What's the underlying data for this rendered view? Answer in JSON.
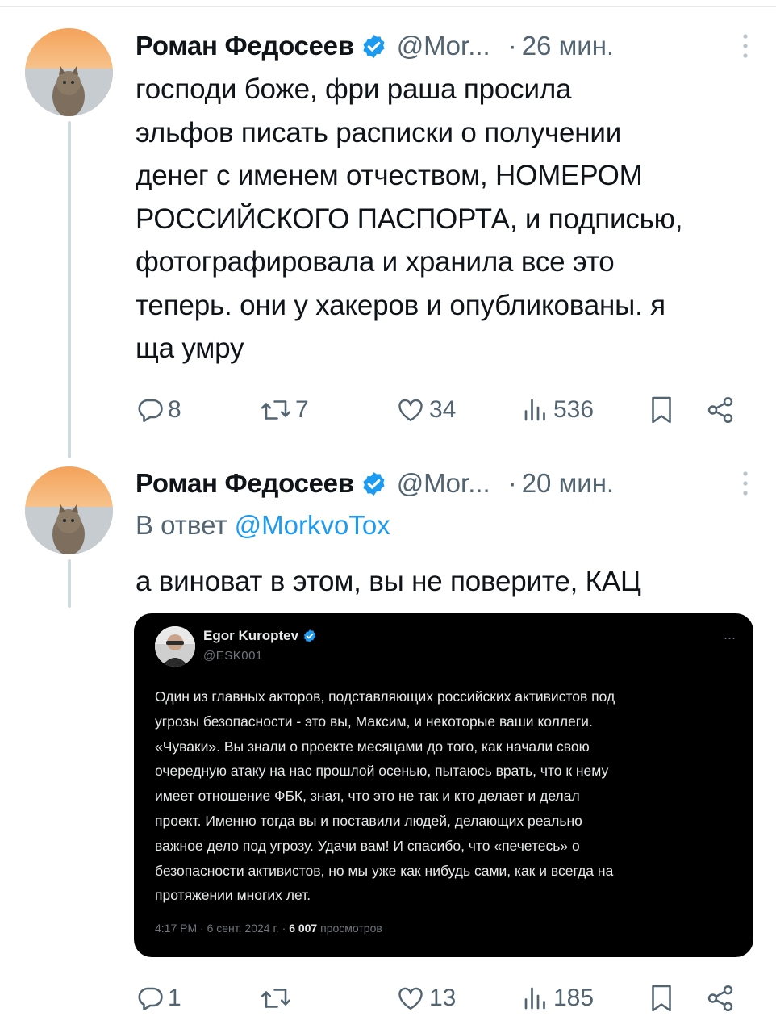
{
  "tweets": [
    {
      "author_name": "Роман Федосеев",
      "handle": "@Mor...",
      "separator": "·",
      "time": "26 мин.",
      "text": "господи боже, фри раша просила\nэльфов писать расписки о получении\nденег с именем отчеством, НОМЕРОМ\nРОССИЙСКОГО ПАСПОРТА, и подписью,\nфотографировала и хранила все это\nтеперь. они у хакеров и опубликованы. я\nща умру",
      "replies": "8",
      "retweets": "7",
      "likes": "34",
      "views": "536"
    },
    {
      "author_name": "Роман Федосеев",
      "handle": "@Mor...",
      "separator": "·",
      "time": "20 мин.",
      "reply_prefix": "В ответ",
      "reply_mention": "@MorkvoTox",
      "text": "а виноват в этом, вы не поверите, КАЦ",
      "replies": "1",
      "retweets": "",
      "likes": "13",
      "views": "185"
    }
  ],
  "quoted": {
    "author_name": "Egor Kuroptev",
    "handle": "@ESK001",
    "more": "...",
    "text": "Один из главных акторов, подставляющих российских активистов под\nугрозы безопасности - это вы, Максим, и некоторые ваши коллеги.\n«Чуваки». Вы знали о проекте месяцами до того, как начали свою\nочередную атаку на нас прошлой осенью, пытаюсь врать, что к нему\nимеет отношение ФБК, зная, что это не так и кто делает и делал\nпроект. Именно тогда вы и поставили людей, делающих реально\nважное дело под угрозу. Удачи вам! И спасибо, что «печетесь» о\nбезопасности активистов, но мы уже как нибудь сами, как и всегда на\nпротяжении многих лет.",
    "timestamp": "4:17 PM · 6 сент. 2024 г. ·",
    "views_count": "6 007",
    "views_label": "просмотров"
  },
  "colors": {
    "accent": "#1d9bf0",
    "secondary_text": "#536471",
    "verified": "#1d9bf0"
  },
  "icons": [
    "reply-icon",
    "retweet-icon",
    "like-icon",
    "views-icon",
    "bookmark-icon",
    "share-icon",
    "verified-icon",
    "more-icon"
  ]
}
